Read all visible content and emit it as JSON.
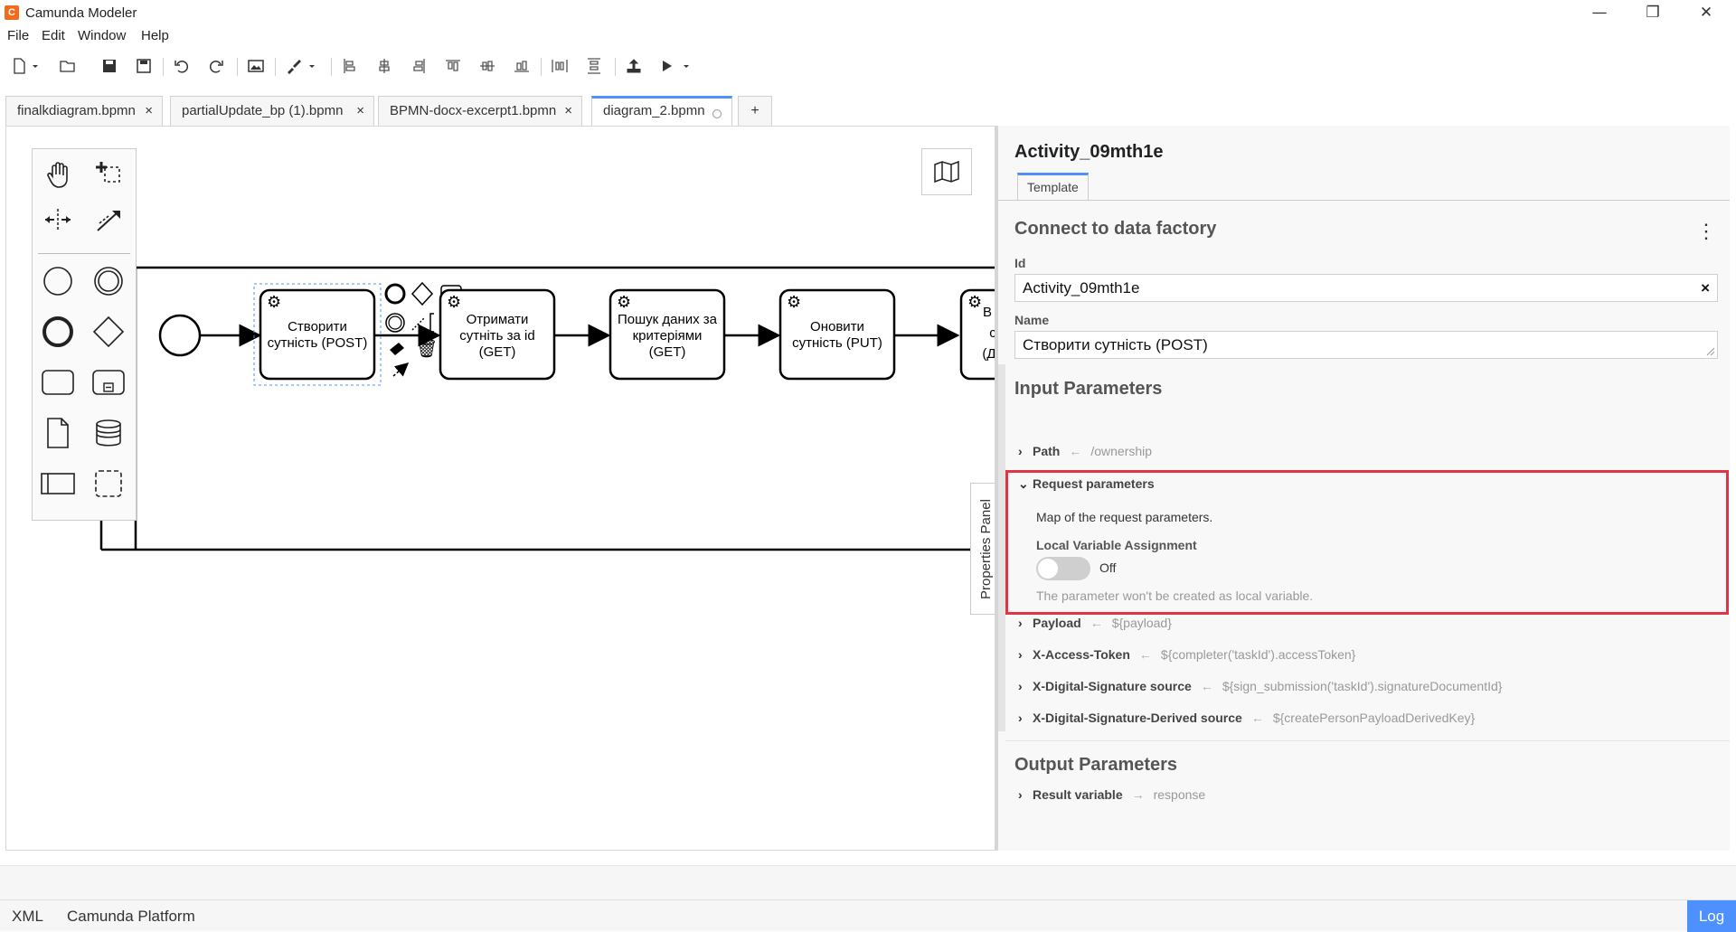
{
  "window": {
    "title": "Camunda Modeler",
    "controls": {
      "minimize": "—",
      "maximize": "❐",
      "close": "✕"
    }
  },
  "menu": [
    "File",
    "Edit",
    "Window",
    "Help"
  ],
  "toolbar": {
    "icons": [
      "new-file-icon",
      "open-file-icon",
      "save-icon",
      "save-as-icon",
      "undo-icon",
      "redo-icon",
      "image-export-icon",
      "color-brush-icon",
      "align-left-icon",
      "align-center-icon",
      "align-right-icon",
      "align-top-icon",
      "align-middle-icon",
      "align-bottom-icon",
      "distribute-horizontal-icon",
      "distribute-vertical-icon",
      "deploy-icon",
      "run-icon"
    ]
  },
  "tabs": [
    {
      "label": "finalkdiagram.bpmn",
      "close": "×",
      "active": false
    },
    {
      "label": "partialUpdate_bp (1).bpmn",
      "close": "×",
      "active": false
    },
    {
      "label": "BPMN-docx-excerpt1.bpmn",
      "close": "×",
      "active": false
    },
    {
      "label": "diagram_2.bpmn",
      "close": "",
      "active": true
    }
  ],
  "tab_add": "+",
  "diagram": {
    "tasks": [
      {
        "line1": "Створити",
        "line2": "сутність (POST)",
        "line3": ""
      },
      {
        "line1": "Отримати",
        "line2": "сутніть за id",
        "line3": "(GET)"
      },
      {
        "line1": "Пошук даних за",
        "line2": "критеріями",
        "line3": "(GET)"
      },
      {
        "line1": "Оновити",
        "line2": "сутність (PUT)",
        "line3": ""
      }
    ],
    "partial_task_fragments": [
      "В",
      "с",
      "(Д"
    ]
  },
  "properties_toggle_label": "Properties Panel",
  "properties": {
    "element_id_title": "Activity_09mth1e",
    "tab_template": "Template",
    "group_title": "Connect to data factory",
    "kebab": "⋮",
    "id_label": "Id",
    "id_value": "Activity_09mth1e",
    "id_clear": "×",
    "name_label": "Name",
    "name_value": "Створити сутність (POST)",
    "input_title": "Input Parameters",
    "path": {
      "name": "Path",
      "arrow": "←",
      "value": "/ownership"
    },
    "request": {
      "name": "Request parameters",
      "description": "Map of the request parameters.",
      "local_label": "Local Variable Assignment",
      "toggle_state": "Off",
      "hint": "The parameter won't be created as local variable."
    },
    "params": [
      {
        "name": "Payload",
        "arrow": "←",
        "value": "${payload}"
      },
      {
        "name": "X-Access-Token",
        "arrow": "←",
        "value": "${completer('taskId').accessToken}"
      },
      {
        "name": "X-Digital-Signature source",
        "arrow": "←",
        "value": "${sign_submission('taskId').signatureDocumentId}"
      },
      {
        "name": "X-Digital-Signature-Derived source",
        "arrow": "←",
        "value": "${createPersonPayloadDerivedKey}"
      }
    ],
    "output_title": "Output Parameters",
    "result": {
      "name": "Result variable",
      "arrow": "→",
      "value": "response"
    }
  },
  "status": {
    "xml": "XML",
    "platform": "Camunda Platform",
    "log": "Log"
  },
  "colors": {
    "accent": "#4d90fe",
    "highlight": "#dc3545",
    "app_icon": "#f26a1b"
  }
}
